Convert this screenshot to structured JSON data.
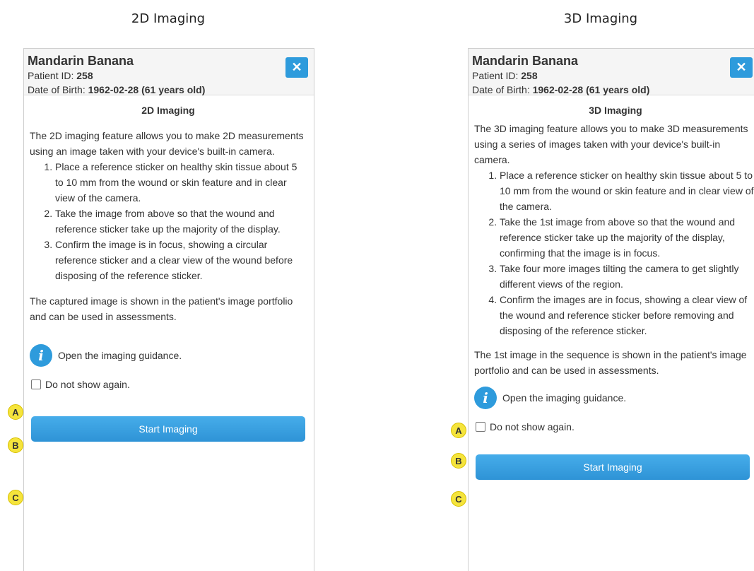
{
  "captions": {
    "left": "2D Imaging",
    "right": "3D Imaging"
  },
  "patient": {
    "name": "Mandarin Banana",
    "id_label": "Patient ID:",
    "id_value": "258",
    "dob_label": "Date of Birth:",
    "dob_value": "1962-02-28 (61 years old)"
  },
  "close_icon": "✕",
  "panel_2d": {
    "title": "2D Imaging",
    "intro": "The 2D imaging feature allows you to make 2D measurements using an image taken with your device's built-in camera.",
    "steps": [
      "Place a reference sticker on healthy skin tissue about 5 to 10 mm from the wound or skin feature and in clear view of the camera.",
      "Take the image from above so that the wound and reference sticker take up the majority of the display.",
      "Confirm the image is in focus, showing a circular reference sticker and a clear view of the wound before disposing of the reference sticker."
    ],
    "outro": "The captured image is shown in the patient's image portfolio and can be used in assessments.",
    "guidance_label": "Open the imaging guidance.",
    "checkbox_label": "Do not show again.",
    "start_label": "Start Imaging"
  },
  "panel_3d": {
    "title": "3D Imaging",
    "intro": "The 3D imaging feature allows you to make 3D measurements using a series of images taken with your device's built-in camera.",
    "steps": [
      "Place a reference sticker on healthy skin tissue about 5 to 10 mm from the wound or skin feature and in clear view of the camera.",
      "Take the 1st image from above so that the wound and reference sticker take up the majority of the display, confirming that the image is in focus.",
      "Take four more images tilting the camera to get slightly different views of the region.",
      "Confirm the images are in focus, showing a clear view of the wound and reference sticker before removing and disposing of the reference sticker."
    ],
    "outro": "The 1st image in the sequence is shown in the patient's image portfolio and can be used in assessments.",
    "guidance_label": "Open the imaging guidance.",
    "checkbox_label": "Do not show again.",
    "start_label": "Start Imaging"
  },
  "info_icon": "i",
  "markers": [
    "A",
    "B",
    "C"
  ],
  "colors": {
    "accent": "#2e9bdc",
    "marker": "#f5e43c"
  }
}
